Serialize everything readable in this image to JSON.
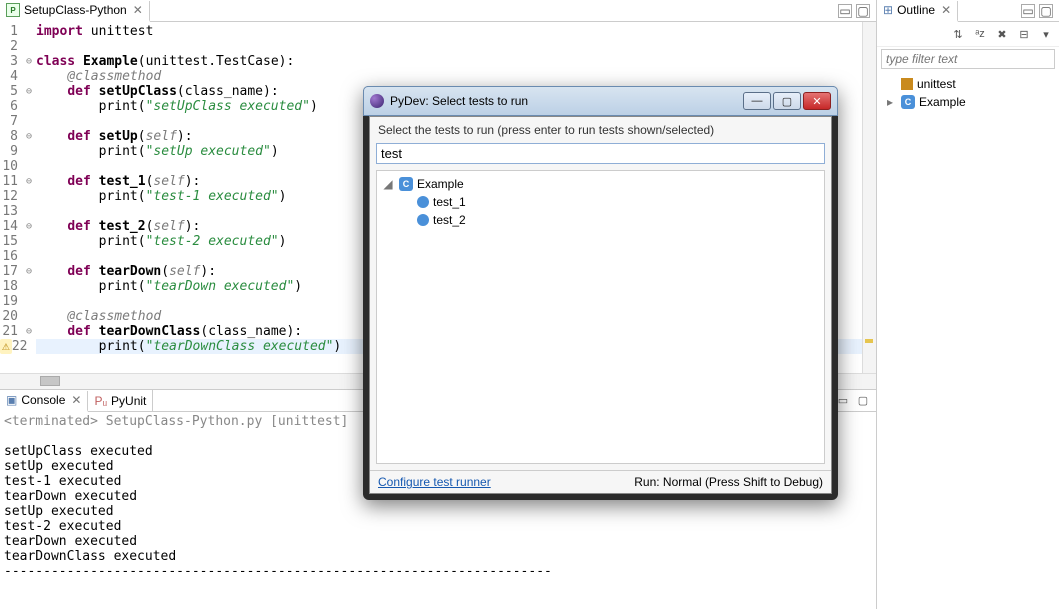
{
  "editor": {
    "tab_title": "SetupClass-Python",
    "lines": [
      {
        "n": 1,
        "fold": "",
        "html": "<span class='kw'>import</span> unittest"
      },
      {
        "n": 2,
        "fold": "",
        "html": ""
      },
      {
        "n": 3,
        "fold": "⊖",
        "html": "<span class='kw'>class</span> <span class='def'>Example</span>(unittest.TestCase):"
      },
      {
        "n": 4,
        "fold": "",
        "html": "    <span class='dec'>@classmethod</span>"
      },
      {
        "n": 5,
        "fold": "⊖",
        "html": "    <span class='kw'>def</span> <span class='def'>setUpClass</span>(class_name):"
      },
      {
        "n": 6,
        "fold": "",
        "html": "        print(<span class='str'>\"setUpClass executed\"</span>)"
      },
      {
        "n": 7,
        "fold": "",
        "html": ""
      },
      {
        "n": 8,
        "fold": "⊖",
        "html": "    <span class='kw'>def</span> <span class='def'>setUp</span>(<span class='dec'>self</span>):"
      },
      {
        "n": 9,
        "fold": "",
        "html": "        print(<span class='str'>\"setUp executed\"</span>)"
      },
      {
        "n": 10,
        "fold": "",
        "html": ""
      },
      {
        "n": 11,
        "fold": "⊖",
        "html": "    <span class='kw'>def</span> <span class='def'>test_1</span>(<span class='dec'>self</span>):"
      },
      {
        "n": 12,
        "fold": "",
        "html": "        print(<span class='str'>\"test-1 executed\"</span>)"
      },
      {
        "n": 13,
        "fold": "",
        "html": ""
      },
      {
        "n": 14,
        "fold": "⊖",
        "html": "    <span class='kw'>def</span> <span class='def'>test_2</span>(<span class='dec'>self</span>):"
      },
      {
        "n": 15,
        "fold": "",
        "html": "        print(<span class='str'>\"test-2 executed\"</span>)"
      },
      {
        "n": 16,
        "fold": "",
        "html": ""
      },
      {
        "n": 17,
        "fold": "⊖",
        "html": "    <span class='kw'>def</span> <span class='def'>tearDown</span>(<span class='dec'>self</span>):"
      },
      {
        "n": 18,
        "fold": "",
        "html": "        print(<span class='str'>\"tearDown executed\"</span>)"
      },
      {
        "n": 19,
        "fold": "",
        "html": ""
      },
      {
        "n": 20,
        "fold": "",
        "html": "    <span class='dec'>@classmethod</span>"
      },
      {
        "n": 21,
        "fold": "⊖",
        "html": "    <span class='kw'>def</span> <span class='def'>tearDownClass</span>(class_name):"
      },
      {
        "n": 22,
        "fold": "",
        "warn": true,
        "cursor": true,
        "html": "        print(<span class='str'>\"tearDownClass executed\"</span>)"
      }
    ]
  },
  "console": {
    "tab_title": "Console",
    "pyunit_tab": "PyUnit",
    "terminated": "<terminated> SetupClass-Python.py [unittest]",
    "output": [
      "setUpClass executed",
      "setUp executed",
      "test-1 executed",
      "tearDown executed",
      "setUp executed",
      "test-2 executed",
      "tearDown executed",
      "tearDownClass executed",
      "----------------------------------------------------------------------"
    ]
  },
  "outline": {
    "title": "Outline",
    "filter_placeholder": "type filter text",
    "items": [
      {
        "icon": "pkg",
        "label": "unittest",
        "indent": 0,
        "exp": ""
      },
      {
        "icon": "c",
        "label": "Example",
        "indent": 0,
        "exp": "▸"
      }
    ]
  },
  "dialog": {
    "title": "PyDev: Select tests to run",
    "instruction": "Select the tests to run (press enter to run tests shown/selected)",
    "input_value": "test",
    "tree": [
      {
        "icon": "c",
        "label": "Example",
        "indent": 0,
        "exp": "◢"
      },
      {
        "icon": "m",
        "label": "test_1",
        "indent": 1,
        "exp": ""
      },
      {
        "icon": "m",
        "label": "test_2",
        "indent": 1,
        "exp": ""
      }
    ],
    "configure": "Configure test runner",
    "run_mode": "Run: Normal   (Press Shift to Debug)"
  }
}
